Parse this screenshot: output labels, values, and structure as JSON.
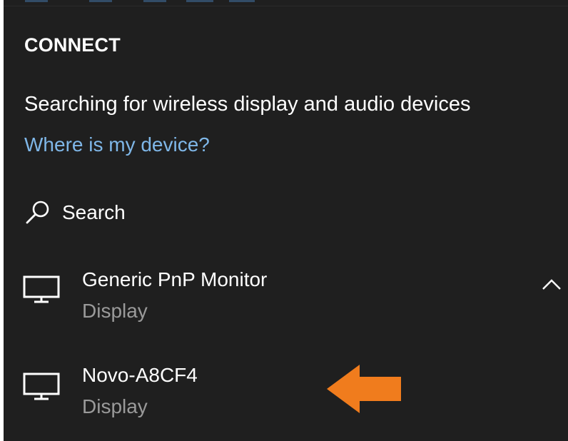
{
  "panel": {
    "title": "CONNECT",
    "status": "Searching for wireless display and audio devices",
    "help_link": "Where is my device?"
  },
  "search": {
    "label": "Search",
    "icon": "search-icon"
  },
  "devices": [
    {
      "name": "Generic PnP Monitor",
      "type": "Display",
      "icon": "monitor-icon",
      "expanded": true
    },
    {
      "name": "Novo-A8CF4",
      "type": "Display",
      "icon": "monitor-icon",
      "expanded": false
    }
  ],
  "annotation": {
    "icon": "arrow-left-icon",
    "color": "#f07c1d"
  },
  "colors": {
    "background": "#1f1f1f",
    "text": "#ffffff",
    "secondary_text": "#9a9a9a",
    "link": "#7fb7e8"
  }
}
